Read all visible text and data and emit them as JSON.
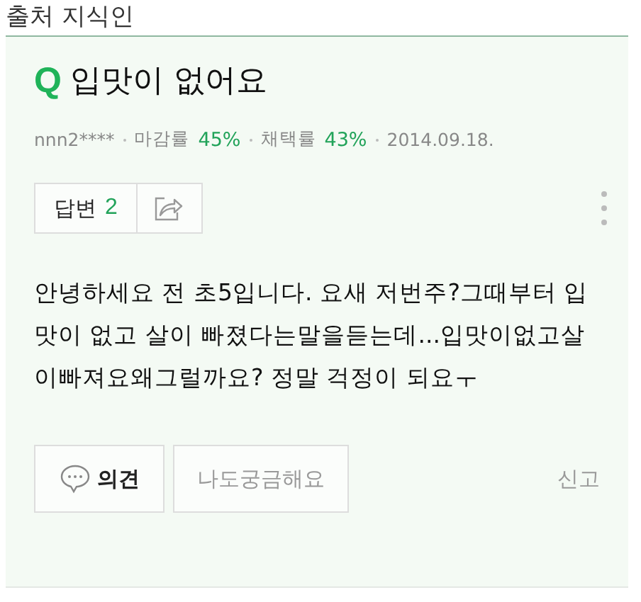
{
  "source": "출처 지식인",
  "question": {
    "badge": "Q",
    "title": "입맛이 없어요",
    "meta": {
      "author": "nnn2****",
      "stats": [
        {
          "label": "마감률",
          "value": "45%"
        },
        {
          "label": "채택률",
          "value": "43%"
        }
      ],
      "date": "2014.09.18."
    },
    "answers": {
      "label": "답변",
      "count": "2"
    },
    "body": "안녕하세요 전 초5입니다. 요새 저번주?그때부터 입맛이 없고 살이 빠졌다는말을듣는데...입맛이없고살이빠져요왜그럴까요? 정말 걱정이 되요ㅜ",
    "actions": [
      {
        "kind": "comment",
        "label": "의견"
      },
      {
        "kind": "plain",
        "label": "나도궁금해요"
      }
    ],
    "report": "신고"
  }
}
